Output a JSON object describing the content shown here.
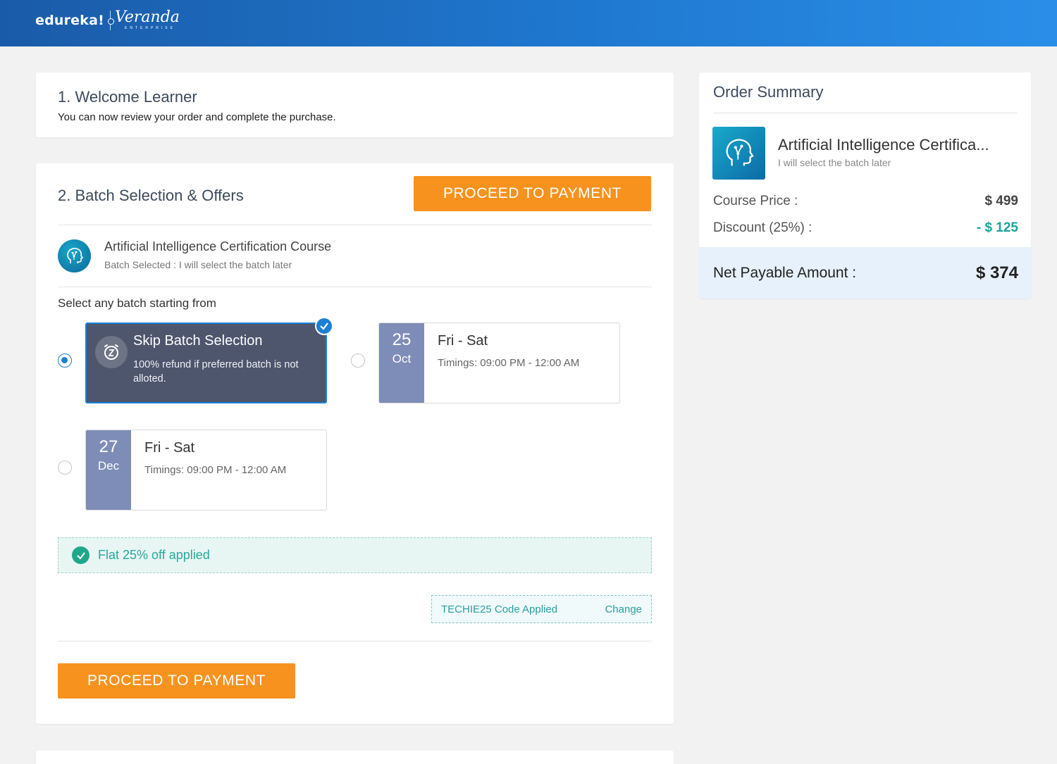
{
  "brand": {
    "logo_text": "edureka!",
    "partner_logo": "Veranda",
    "partner_sub": "ENTERPRISE"
  },
  "welcome": {
    "title": "1. Welcome Learner",
    "subtitle": "You can now review your order and complete the purchase."
  },
  "batch": {
    "title": "2. Batch Selection & Offers",
    "proceed_label": "PROCEED TO PAYMENT",
    "course_title": "Artificial Intelligence Certification Course",
    "course_batch_selected": "Batch Selected : I will select the batch later",
    "select_label": "Select any batch starting from",
    "skip_option": {
      "title": "Skip Batch Selection",
      "description": "100% refund if preferred batch is not alloted.",
      "selected": true,
      "icon": "alarm-clock-icon"
    },
    "batches": [
      {
        "day": "25",
        "month": "Oct",
        "days": "Fri - Sat",
        "timing": "Timings: 09:00 PM - 12:00 AM",
        "selected": false
      },
      {
        "day": "27",
        "month": "Dec",
        "days": "Fri - Sat",
        "timing": "Timings: 09:00 PM - 12:00 AM",
        "selected": false
      }
    ],
    "offer_text": "Flat 25% off applied",
    "coupon": {
      "code_text": "TECHIE25 Code Applied",
      "change_label": "Change"
    },
    "proceed_bottom_label": "PROCEED TO PAYMENT"
  },
  "summary": {
    "title": "Order Summary",
    "course_title": "Artificial Intelligence Certifica...",
    "course_sub": "I will select the batch later",
    "price_label": "Course Price :",
    "price_value": "$ 499",
    "discount_label": "Discount (25%) :",
    "discount_value": "- $ 125",
    "net_label": "Net Payable Amount :",
    "net_value": "$ 374"
  },
  "colors": {
    "accent_orange": "#f7921e",
    "primary_blue": "#1c7fd6",
    "success_teal": "#1ea889",
    "header_blue": "#1a5ba8"
  }
}
